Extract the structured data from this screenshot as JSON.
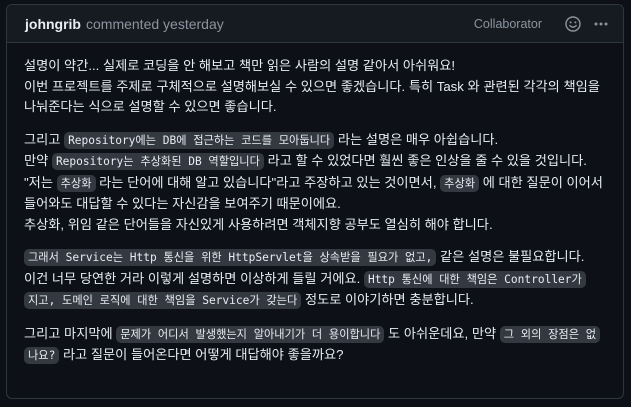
{
  "header": {
    "author": "johngrib",
    "action": "commented yesterday",
    "role": "Collaborator",
    "reaction_icon": "smiley-icon",
    "menu_icon": "kebab-horizontal-icon"
  },
  "body": {
    "p1": {
      "l1": "설명이 약간... 실제로 코딩을 안 해보고 책만 읽은 사람의 설명 같아서 아쉬워요!",
      "l2": "이번 프로젝트를 주제로 구체적으로 설명해보실 수 있으면 좋겠습니다. 특히 Task 와 관련된 각각의 책임을",
      "l3": "나눠준다는 식으로 설명할 수 있으면 좋습니다."
    },
    "p2": {
      "l1_a": "그리고 ",
      "l1_code": "Repository에는 DB에 접근하는 코드를 모아둡니다",
      "l1_b": " 라는 설명은 매우 아쉽습니다.",
      "l2_a": "만약 ",
      "l2_code": "Repository는 추상화된 DB 역할입니다",
      "l2_b": " 라고 할 수 있었다면 훨씬 좋은 인상을 줄 수 있을 것입니다.",
      "l3_a": "\"저는 ",
      "l3_code1": "추상화",
      "l3_b": " 라는 단어에 대해 알고 있습니다\"라고 주장하고 있는 것이면서, ",
      "l3_code2": "추상화",
      "l3_c": " 에 대한 질문이 이어서",
      "l4": "들어와도 대답할 수 있다는 자신감을 보여주기 때문이에요.",
      "l5": "추상화, 위임 같은 단어들을 자신있게 사용하려면 객체지향 공부도 열심히 해야 합니다."
    },
    "p3": {
      "l1_code": "그래서 Service는 Http 통신을 위한 HttpServlet을 상속받을 필요가 없고,",
      "l1_b": " 같은 설명은 불필요합니다.",
      "l2_a": "이건 너무 당연한 거라 이렇게 설명하면 이상하게 들릴 거에요. ",
      "l2_code": "Http 통신에 대한 책임은 Controller가",
      "l3_code": "지고, 도메인 로직에 대한 책임을 Service가 갖는다",
      "l3_b": " 정도로 이야기하면 충분합니다."
    },
    "p4": {
      "l1_a": "그리고 마지막에 ",
      "l1_code": "문제가 어디서 발생했는지 알아내기가 더 용이합니다",
      "l1_b": " 도 아쉬운데요, 만약 ",
      "l1_code2": "그 외의 장점은 없",
      "l2_code": "나요?",
      "l2_b": " 라고 질문이 들어온다면 어떻게 대답해야 좋을까요?"
    }
  },
  "colors": {
    "background": "#0d1117",
    "header_bg": "#161b22",
    "border": "#30363d",
    "muted_text": "#8b949e",
    "code_bg": "#343941"
  }
}
